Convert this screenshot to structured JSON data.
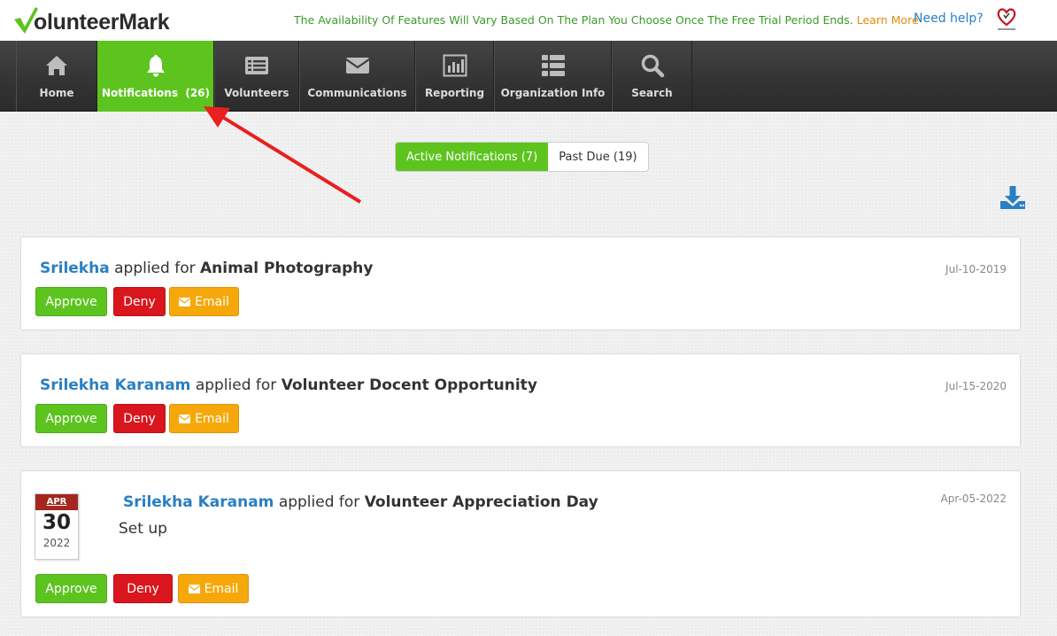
{
  "header": {
    "logo_text": "olunteerMark",
    "trial_message": "The Availability Of Features Will Vary Based On The Plan You Choose Once The Free Trial Period Ends.",
    "learn_more": "Learn More",
    "need_help": "Need help?"
  },
  "nav": {
    "items": [
      {
        "label": "Home",
        "icon": "home-icon"
      },
      {
        "label": "Notifications  (26)",
        "icon": "bell-icon",
        "active": true
      },
      {
        "label": "Volunteers",
        "icon": "list-icon"
      },
      {
        "label": "Communications",
        "icon": "envelope-icon"
      },
      {
        "label": "Reporting",
        "icon": "bar-chart-icon"
      },
      {
        "label": "Organization Info",
        "icon": "org-list-icon"
      },
      {
        "label": "Search",
        "icon": "search-icon"
      }
    ]
  },
  "tabs": {
    "active": "Active Notifications (7)",
    "past_due": "Past Due (19)"
  },
  "colors": {
    "accent_green": "#5dc41f",
    "deny_red": "#d9161d",
    "email_orange": "#f6a80b",
    "link_blue": "#2a7fc1",
    "annotation_red": "#e8201f"
  },
  "notifications": [
    {
      "who": "Srilekha",
      "verb": "applied for",
      "what": "Animal Photography",
      "date": "Jul-10-2019",
      "approve": "Approve",
      "deny": "Deny",
      "email": "Email"
    },
    {
      "who": "Srilekha Karanam",
      "verb": "applied for",
      "what": "Volunteer Docent Opportunity",
      "date": "Jul-15-2020",
      "approve": "Approve",
      "deny": "Deny",
      "email": "Email"
    },
    {
      "who": "Srilekha Karanam",
      "verb": "applied for",
      "what": "Volunteer Appreciation Day",
      "date": "Apr-05-2022",
      "note": "Set up",
      "calendar": {
        "month": "APR",
        "day": "30",
        "year": "2022"
      },
      "approve": "Approve",
      "deny": "Deny",
      "email": "Email"
    }
  ]
}
